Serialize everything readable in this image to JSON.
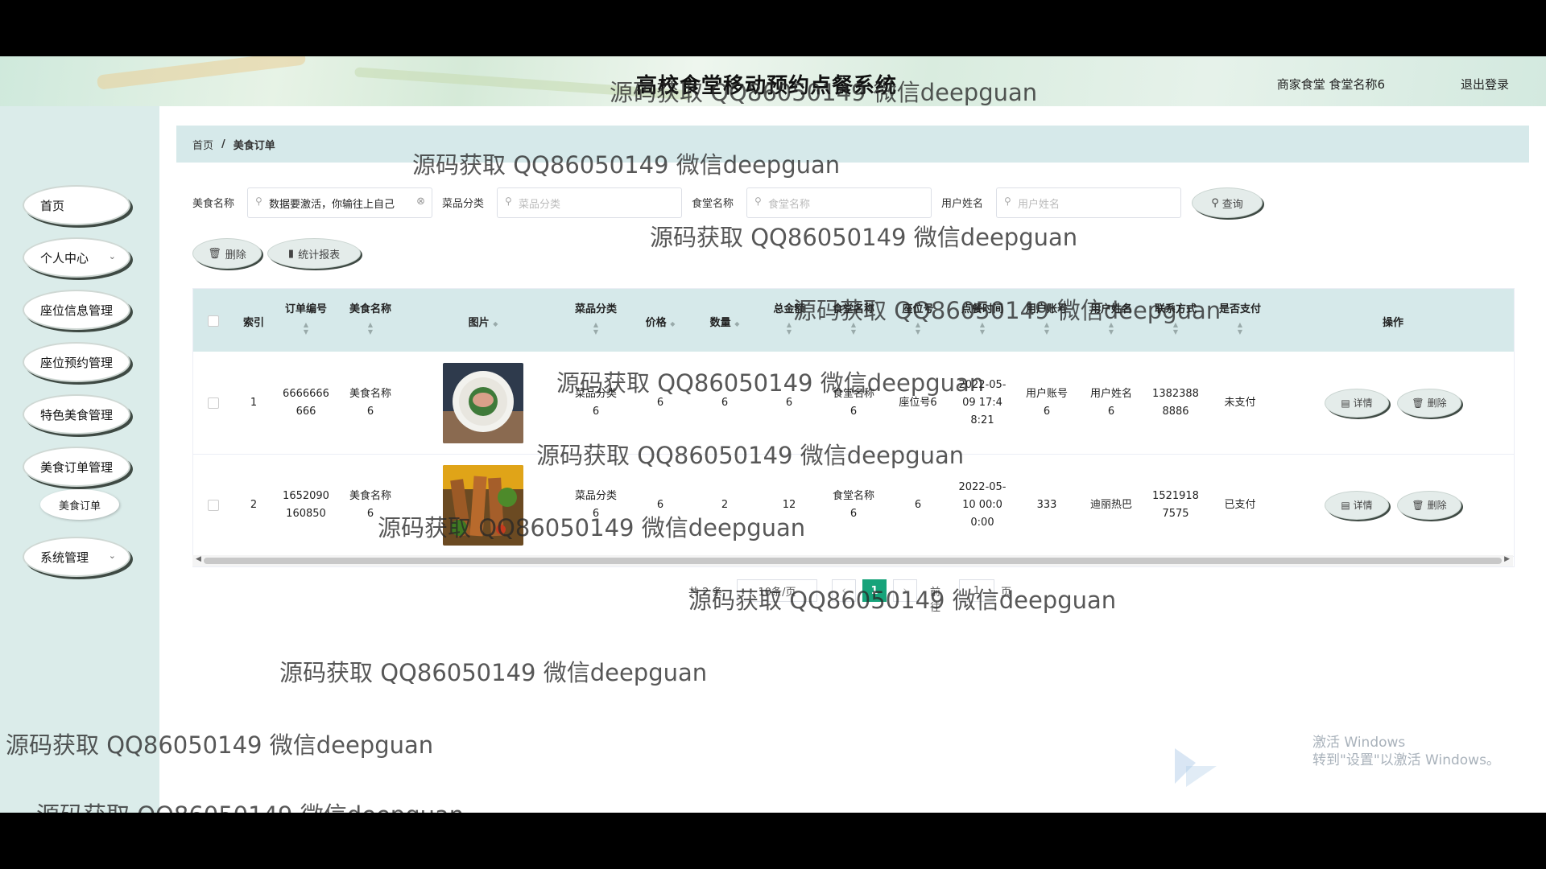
{
  "header": {
    "title": "高校食堂移动预约点餐系统",
    "user": "商家食堂 食堂名称6",
    "logout": "退出登录"
  },
  "sidebar": {
    "items": [
      {
        "label": "首页"
      },
      {
        "label": "个人中心"
      },
      {
        "label": "座位信息管理"
      },
      {
        "label": "座位预约管理"
      },
      {
        "label": "特色美食管理"
      },
      {
        "label": "美食订单管理"
      },
      {
        "label": "系统管理"
      }
    ],
    "sub_item": "美食订单"
  },
  "breadcrumb": {
    "home": "首页",
    "sep": "/",
    "current": "美食订单"
  },
  "search": {
    "fields": [
      {
        "label": "美食名称",
        "value": "数据要激活，你输往上自己"
      },
      {
        "label": "菜品分类",
        "placeholder": "菜品分类"
      },
      {
        "label": "食堂名称",
        "placeholder": "食堂名称"
      },
      {
        "label": "用户姓名",
        "placeholder": "用户姓名"
      }
    ],
    "query": "查询"
  },
  "actions": {
    "delete": "删除",
    "report": "统计报表"
  },
  "table": {
    "columns": [
      "索引",
      "订单编号",
      "美食名称",
      "图片",
      "菜品分类",
      "价格",
      "数量",
      "总金额",
      "食堂名称",
      "座位号",
      "点餐时间",
      "用户账号",
      "用户姓名",
      "联系方式",
      "是否支付",
      "操作"
    ],
    "rows": [
      {
        "index": "1",
        "order_no": "6666666666",
        "food": "美食名称6",
        "category": "菜品分类6",
        "price": "6",
        "qty": "6",
        "total": "6",
        "canteen": "食堂名称6",
        "seat": "座位号6",
        "time": "2022-05-09 17:48:21",
        "account": "用户账号6",
        "name": "用户姓名6",
        "phone": "13823888886",
        "paid": "未支付"
      },
      {
        "index": "2",
        "order_no": "1652090160850",
        "food": "美食名称6",
        "category": "菜品分类6",
        "price": "6",
        "qty": "2",
        "total": "12",
        "canteen": "食堂名称6",
        "seat": "6",
        "time": "2022-05-10 00:00:00",
        "account": "333",
        "name": "迪丽热巴",
        "phone": "15219187575",
        "paid": "已支付"
      }
    ],
    "detail": "详情",
    "delete": "删除"
  },
  "pagination": {
    "total": "共 2 条",
    "size": "10条/页",
    "page": "1",
    "goto": "前往",
    "goto_page": "1",
    "unit": "页"
  },
  "watermark": "源码获取 QQ86050149 微信deepguan",
  "windows": {
    "line1": "激活 Windows",
    "line2": "转到\"设置\"以激活 Windows。"
  }
}
